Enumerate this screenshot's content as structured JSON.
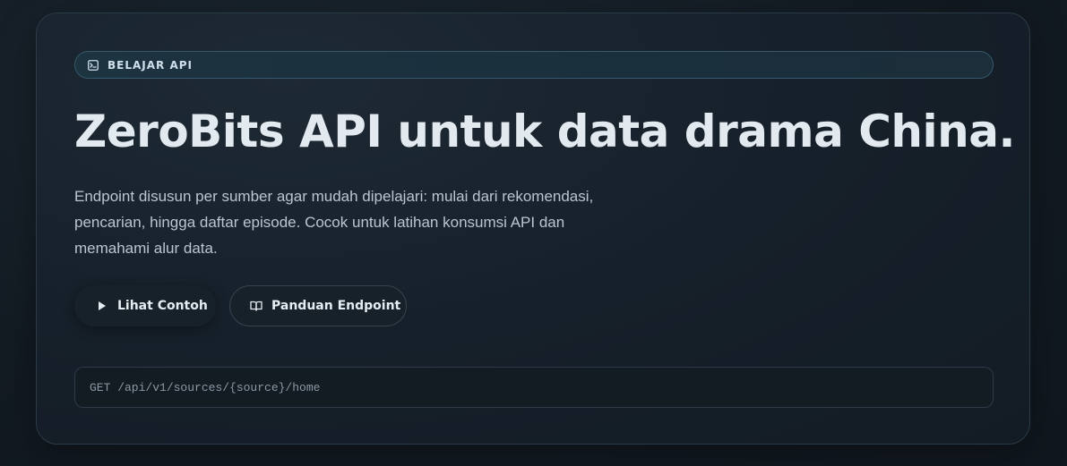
{
  "badge": {
    "icon": "terminal-icon",
    "label": "BELAJAR API"
  },
  "hero": {
    "title": "ZeroBits API untuk data drama China.",
    "description": "Endpoint disusun per sumber agar mudah dipelajari: mulai dari rekomendasi, pencarian, hingga daftar episode. Cocok untuk latihan konsumsi API dan memahami alur data."
  },
  "actions": {
    "primary": {
      "icon": "play-icon",
      "label": "Lihat Contoh"
    },
    "secondary": {
      "icon": "book-icon",
      "label": "Panduan Endpoint"
    }
  },
  "endpoint": {
    "text": "GET /api/v1/sources/{source}/home"
  },
  "colors": {
    "background": "#111921",
    "card_border": "#2a3a46",
    "badge_border": "#36586a",
    "title": "#e2e9ef",
    "body_text": "#b9c6d0"
  }
}
